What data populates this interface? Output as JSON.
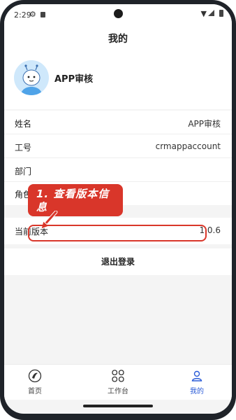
{
  "status_bar": {
    "time": "2:29"
  },
  "header": {
    "title": "我的"
  },
  "profile": {
    "name": "APP审核"
  },
  "info": [
    {
      "label": "姓名",
      "value": "APP审核"
    },
    {
      "label": "工号",
      "value": "crmappaccount"
    },
    {
      "label": "部门",
      "value": ""
    },
    {
      "label": "角色",
      "value": ""
    }
  ],
  "version": {
    "label": "当前版本",
    "value": "1.0.6"
  },
  "logout": {
    "label": "退出登录"
  },
  "annotation": {
    "text_line1": "1. 查看版本信",
    "text_line2": "息",
    "color": "#d9362a"
  },
  "tabbar": {
    "items": [
      {
        "label": "首页",
        "icon": "home-logo-icon"
      },
      {
        "label": "工作台",
        "icon": "grid-icon"
      },
      {
        "label": "我的",
        "icon": "person-icon",
        "active": true
      }
    ],
    "active_color": "#2a5bd7"
  }
}
